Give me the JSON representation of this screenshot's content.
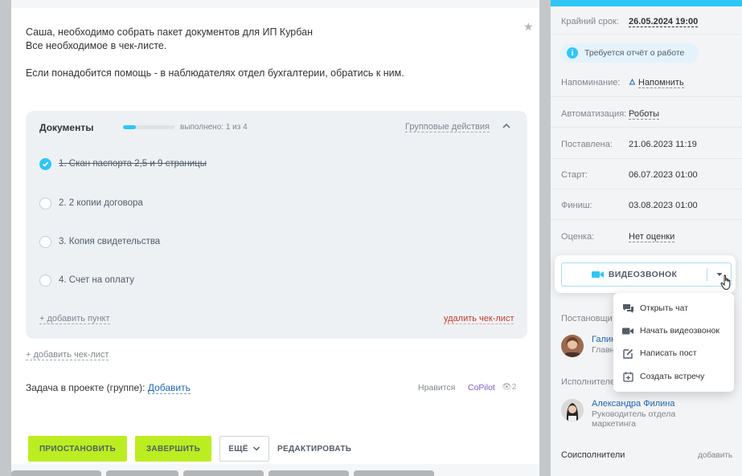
{
  "task": {
    "description_lines": [
      "Саша, необходимо собрать пакет документов для ИП Курбан",
      "Все необходимое в чек-листе.",
      "Если понадобится помощь - в наблюдателях отдел бухгалтерии, обратись к ним."
    ]
  },
  "checklist": {
    "title": "Документы",
    "progress_text": "выполнено: 1 из 4",
    "progress_fraction": 0.25,
    "group_actions": "Групповые действия",
    "items": [
      {
        "label": "1. Скан паспорта 2,5 и 9 страницы",
        "done": true
      },
      {
        "label": "2. 2 копии договора",
        "done": false
      },
      {
        "label": "3. Копия свидетельства",
        "done": false
      },
      {
        "label": "4. Счет на оплату",
        "done": false
      }
    ],
    "add_item": "+ добавить пункт",
    "delete": "удалить чек-лист"
  },
  "add_checklist": "+ добавить чек-лист",
  "project": {
    "label": "Задача в проекте (группе):",
    "link": "Добавить"
  },
  "social": {
    "likes": "Нравится",
    "copilot": "CoPilot",
    "views": "2"
  },
  "footer": {
    "pause": "ПРИОСТАНОВИТЬ",
    "complete": "ЗАВЕРШИТЬ",
    "more": "ЕЩЁ",
    "edit": "РЕДАКТИРОВАТЬ"
  },
  "sidebar": {
    "deadline_label": "Крайний срок:",
    "deadline_value": "26.05.2024 19:00",
    "report_badge": "Требуется отчёт о работе",
    "reminder_label": "Напоминание:",
    "reminder_value": "Напомнить",
    "automation_label": "Автоматизация:",
    "automation_value": "Роботы",
    "created_label": "Поставлена:",
    "created_value": "21.06.2023 11:19",
    "start_label": "Старт:",
    "start_value": "06.07.2023 01:00",
    "finish_label": "Финиш:",
    "finish_value": "03.08.2023 01:00",
    "rating_label": "Оценка:",
    "rating_value": "Нет оценки",
    "creator_label": "Постановщи",
    "creator_name": "Галин",
    "creator_role": "Главн",
    "assignee_label": "Исполнителе",
    "assignee_name": "Александра Филина",
    "assignee_role_1": "Руководитель отдела",
    "assignee_role_2": "маркетинга",
    "coexecutors_label": "Соисполнители",
    "coexecutors_add": "добавить"
  },
  "video_call": {
    "label": "ВИДЕОЗВОНОК",
    "accent": "#2fc6f6"
  },
  "dropdown": {
    "items": [
      {
        "label": "Открыть чат",
        "icon": "chat-icon"
      },
      {
        "label": "Начать видеозвонок",
        "icon": "video-camera-icon"
      },
      {
        "label": "Написать пост",
        "icon": "edit-post-icon"
      },
      {
        "label": "Создать встречу",
        "icon": "calendar-icon"
      }
    ]
  }
}
